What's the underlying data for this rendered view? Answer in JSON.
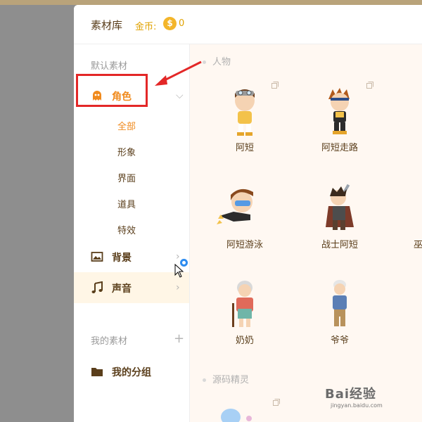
{
  "header": {
    "title": "素材库",
    "coins_label": "金币:",
    "coin_symbol": "$",
    "coins_value": "0"
  },
  "sidebar": {
    "default_section": "默认素材",
    "items": [
      {
        "label": "角色",
        "icon": "ghost-icon"
      },
      {
        "label": "背景",
        "icon": "image-icon"
      },
      {
        "label": "声音",
        "icon": "music-note-icon"
      }
    ],
    "sub_items": [
      "全部",
      "形象",
      "界面",
      "道具",
      "特效"
    ],
    "my_section": "我的素材",
    "my_group": "我的分组"
  },
  "content": {
    "groups": [
      {
        "label": "人物"
      },
      {
        "label": "源码精灵"
      }
    ],
    "assets": [
      {
        "name": "阿短"
      },
      {
        "name": "阿短走路"
      },
      {
        "name": "阿短游泳"
      },
      {
        "name": "战士阿短"
      },
      {
        "name": "奶奶"
      },
      {
        "name": "爷爷"
      }
    ],
    "partial_label": "巫"
  },
  "watermark": {
    "text": "Bai经验",
    "sub": "jingyan.baidu.com"
  },
  "colors": {
    "accent": "#f08a1d",
    "highlight": "#e32727",
    "selected_bg": "#fff6e6",
    "coin": "#f3b52a"
  }
}
